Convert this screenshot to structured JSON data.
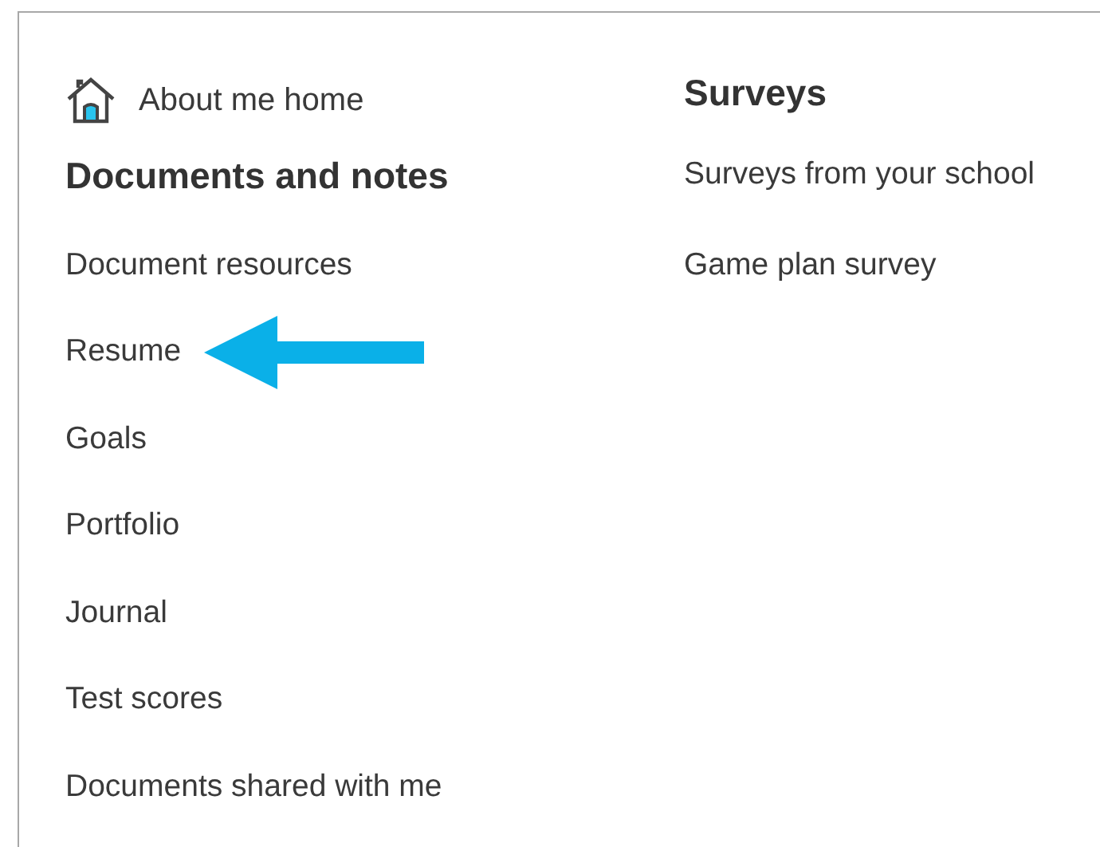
{
  "home_link": {
    "label": "About me home"
  },
  "documents": {
    "heading": "Documents and notes",
    "links": [
      {
        "label": "Document resources",
        "marked": false
      },
      {
        "label": "Resume",
        "marked": true
      },
      {
        "label": "Goals",
        "marked": false
      },
      {
        "label": "Portfolio",
        "marked": false
      },
      {
        "label": "Journal",
        "marked": false
      },
      {
        "label": "Test scores",
        "marked": false
      },
      {
        "label": "Documents shared with me",
        "marked": false
      }
    ]
  },
  "surveys": {
    "heading": "Surveys",
    "links": [
      {
        "label": "Surveys from your school",
        "marked": false
      },
      {
        "label": "Game plan survey",
        "marked": false
      }
    ]
  }
}
